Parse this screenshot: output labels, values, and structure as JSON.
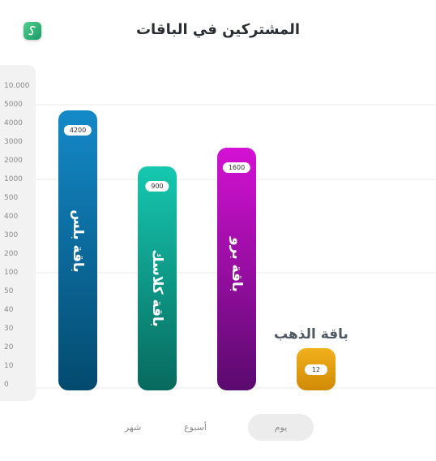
{
  "title": "المشتركين في الباقات",
  "chart_data": {
    "type": "bar",
    "yticks": [
      "10.000",
      "5000",
      "4000",
      "3000",
      "2000",
      "1000",
      "500",
      "400",
      "300",
      "200",
      "100",
      "50",
      "40",
      "30",
      "20",
      "10",
      "0"
    ],
    "categories": [
      "باقة بلس",
      "باقة كلاسك",
      "باقة برو",
      "باقة الذهب"
    ],
    "values": [
      4200,
      900,
      1600,
      12
    ],
    "value_labels": [
      "4200",
      "900",
      "1600",
      "12"
    ],
    "colors": [
      [
        "#1489c8",
        "#034a6e"
      ],
      [
        "#16c8b0",
        "#07695e"
      ],
      [
        "#d411d4",
        "#5a0a6e"
      ],
      [
        "#f2b01c",
        "#d08a06"
      ]
    ],
    "grid": true
  },
  "segmented": {
    "options": [
      "يوم",
      "أسبوع",
      "شهر"
    ],
    "selected": "يوم"
  }
}
